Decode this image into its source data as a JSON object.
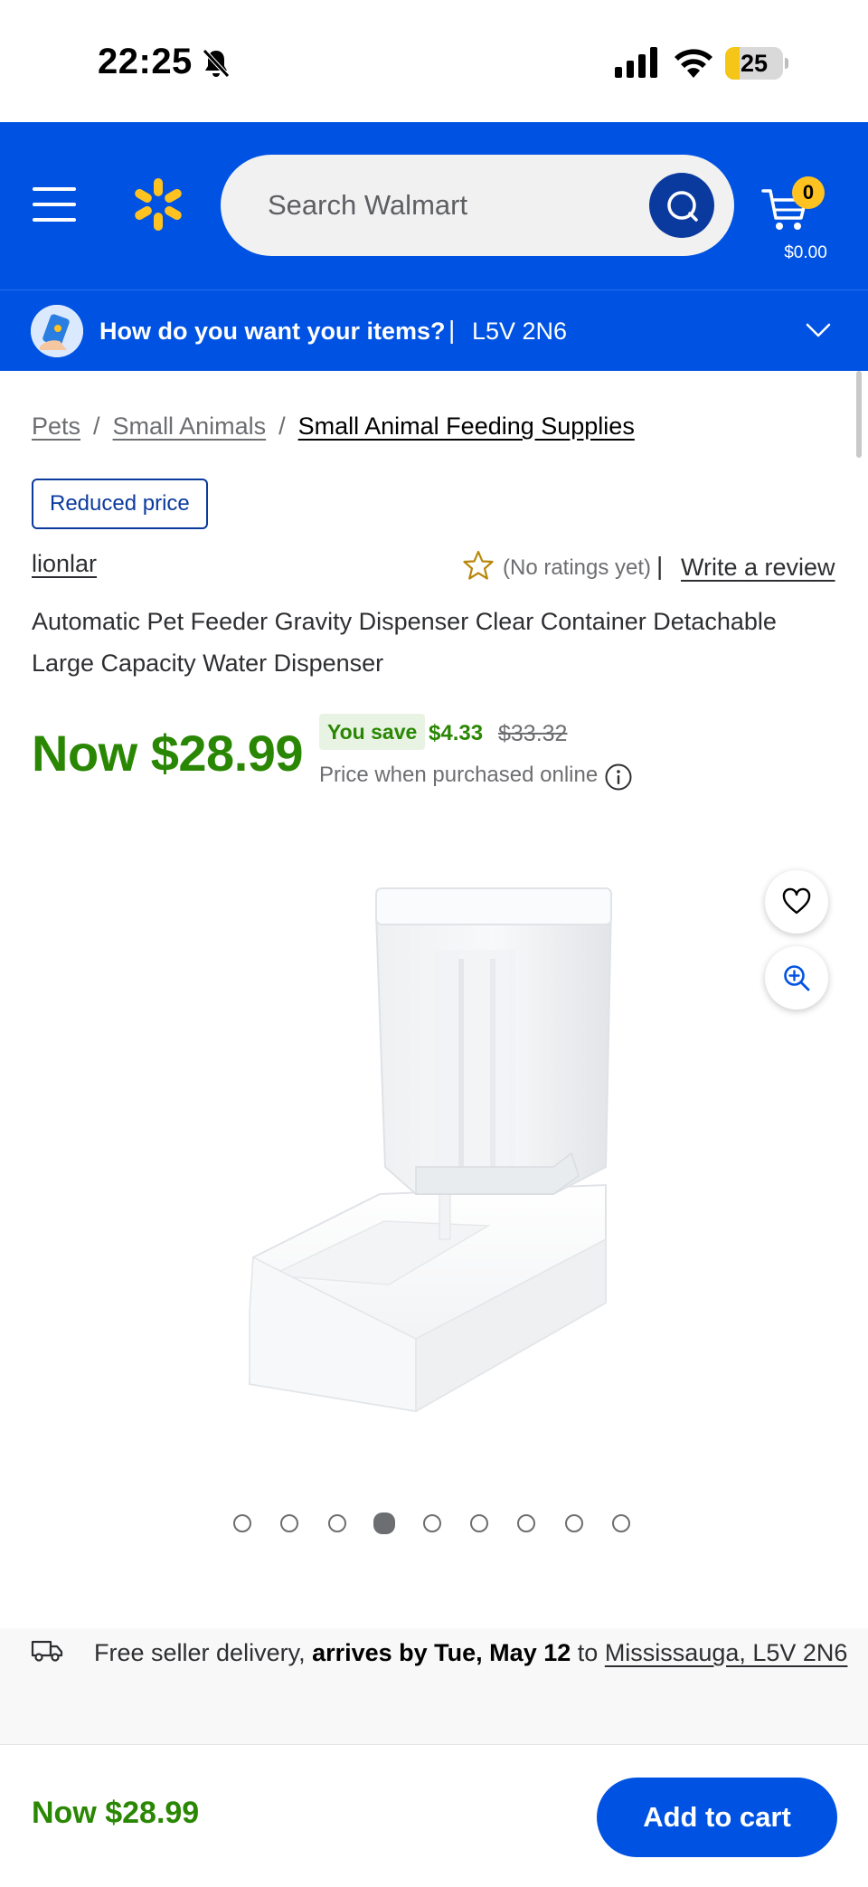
{
  "status_bar": {
    "time": "22:25",
    "battery_percent": 25,
    "battery_label": "25"
  },
  "header": {
    "search_placeholder": "Search Walmart",
    "cart_count": "0",
    "cart_total": "$0.00",
    "brand_color": "#0053e2",
    "spark_color": "#ffc220"
  },
  "location": {
    "question": "How do you want your items?",
    "separator": "|",
    "postal_code": "L5V 2N6"
  },
  "breadcrumb": {
    "items": [
      "Pets",
      "Small Animals",
      "Small Animal Feeding Supplies"
    ],
    "separator": "/"
  },
  "product": {
    "badge": "Reduced price",
    "brand": "lionlar",
    "rating_text": "(No ratings yet)",
    "rating_separator": "|",
    "write_review": "Write a review",
    "title": "Automatic Pet Feeder Gravity Dispenser Clear Container Detachable Large Capacity Water Dispenser",
    "price_now": "Now $28.99",
    "you_save_label": "You save",
    "savings": "$4.33",
    "old_price": "$33.32",
    "price_note": "Price when purchased online",
    "image_count": 9,
    "active_image": 4,
    "price_color": "#2a8703"
  },
  "delivery": {
    "prefix": "Free seller delivery,",
    "arrival": "arrives by Tue, May 12",
    "to": "to",
    "location": "Mississauga, L5V 2N6"
  },
  "bottom_bar": {
    "price": "Now $28.99",
    "add_to_cart": "Add to cart"
  }
}
